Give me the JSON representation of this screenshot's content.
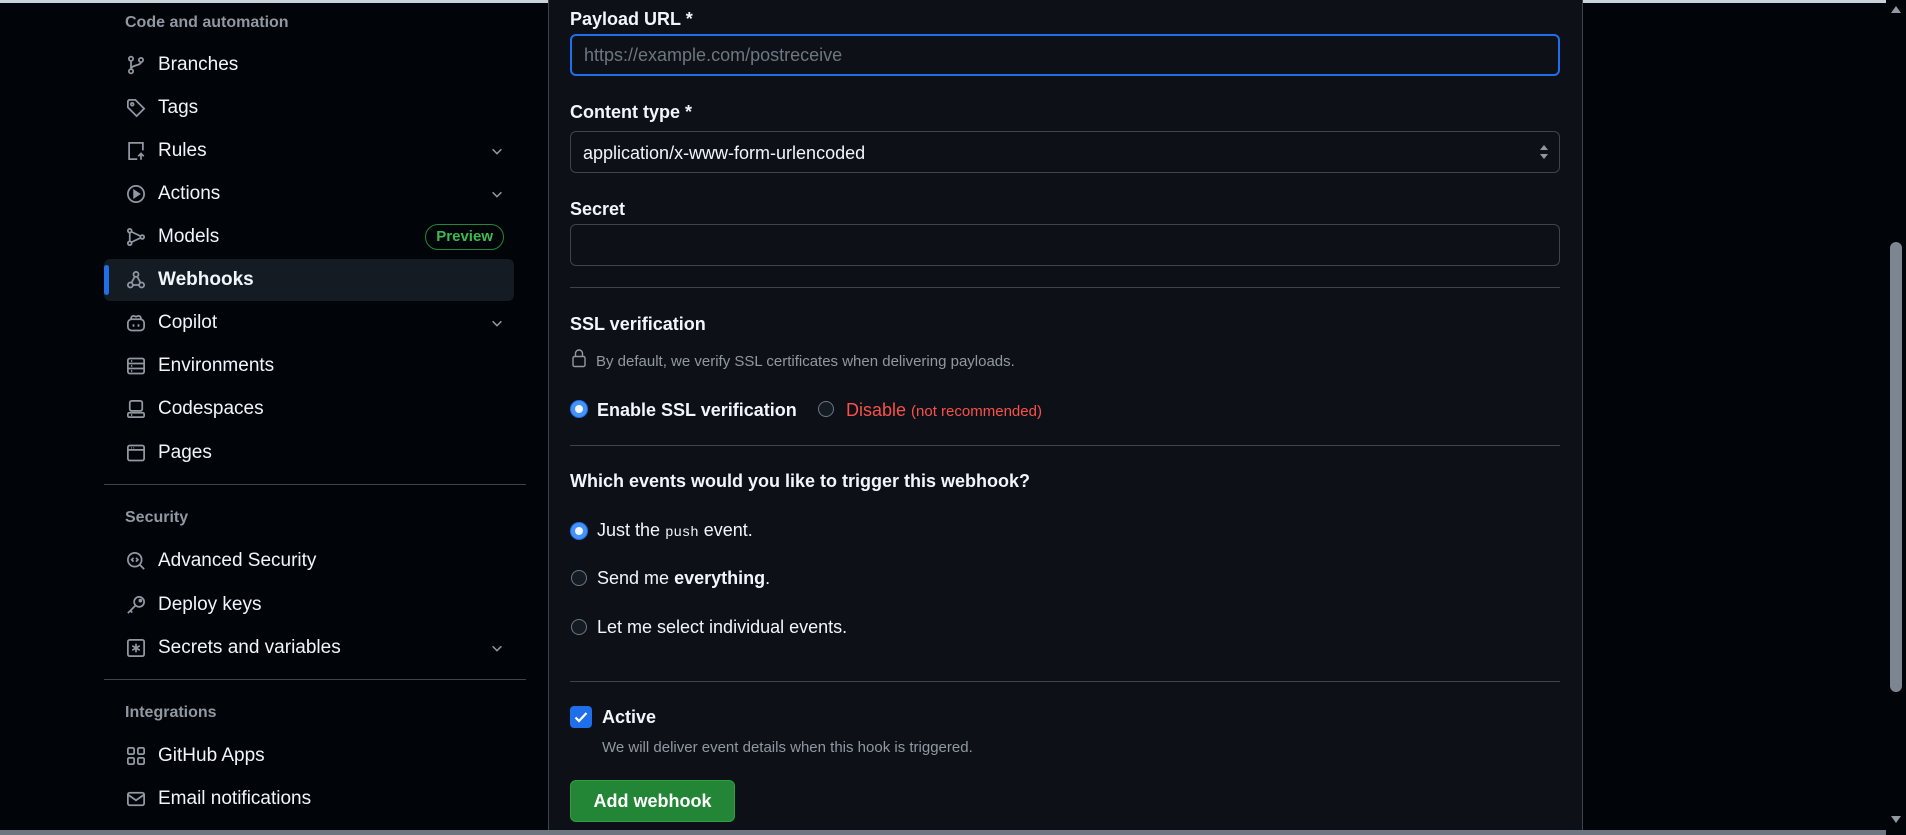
{
  "sidebar": {
    "section_code": "Code and automation",
    "items_code": [
      {
        "label": "Branches",
        "icon": "branch-icon"
      },
      {
        "label": "Tags",
        "icon": "tag-icon"
      },
      {
        "label": "Rules",
        "icon": "rules-icon"
      },
      {
        "label": "Actions",
        "icon": "play-icon"
      },
      {
        "label": "Models",
        "icon": "models-icon",
        "badge": "Preview"
      },
      {
        "label": "Webhooks",
        "icon": "webhook-icon",
        "active": true
      },
      {
        "label": "Copilot",
        "icon": "copilot-icon"
      },
      {
        "label": "Environments",
        "icon": "server-icon"
      },
      {
        "label": "Codespaces",
        "icon": "codespaces-icon"
      },
      {
        "label": "Pages",
        "icon": "browser-icon"
      }
    ],
    "section_security": "Security",
    "items_security": [
      {
        "label": "Advanced Security",
        "icon": "codescan-icon"
      },
      {
        "label": "Deploy keys",
        "icon": "key-icon"
      },
      {
        "label": "Secrets and variables",
        "icon": "asterisk-icon"
      }
    ],
    "section_integrations": "Integrations",
    "items_integrations": [
      {
        "label": "GitHub Apps",
        "icon": "apps-icon"
      },
      {
        "label": "Email notifications",
        "icon": "mail-icon"
      }
    ]
  },
  "form": {
    "payload_label": "Payload URL *",
    "payload_placeholder": "https://example.com/postreceive",
    "payload_value": "",
    "content_type_label": "Content type *",
    "content_type_value": "application/x-www-form-urlencoded",
    "secret_label": "Secret",
    "secret_value": "",
    "ssl_title": "SSL verification",
    "ssl_note": "By default, we verify SSL certificates when delivering payloads.",
    "ssl_enable": "Enable SSL verification",
    "ssl_disable": "Disable",
    "ssl_disable_note": "(not recommended)",
    "ssl_selected": "enable",
    "events_title": "Which events would you like to trigger this webhook?",
    "event_push_pre": "Just the",
    "event_push_code": "push",
    "event_push_post": "event.",
    "event_all_pre": "Send me",
    "event_all_bold": "everything",
    "event_all_post": ".",
    "event_select": "Let me select individual events.",
    "events_selected": "push",
    "active_label": "Active",
    "active_checked": true,
    "active_note": "We will deliver event details when this hook is triggered.",
    "submit_label": "Add webhook"
  },
  "colors": {
    "accent": "#1f6feb",
    "danger": "#f85149",
    "success": "#238636"
  }
}
